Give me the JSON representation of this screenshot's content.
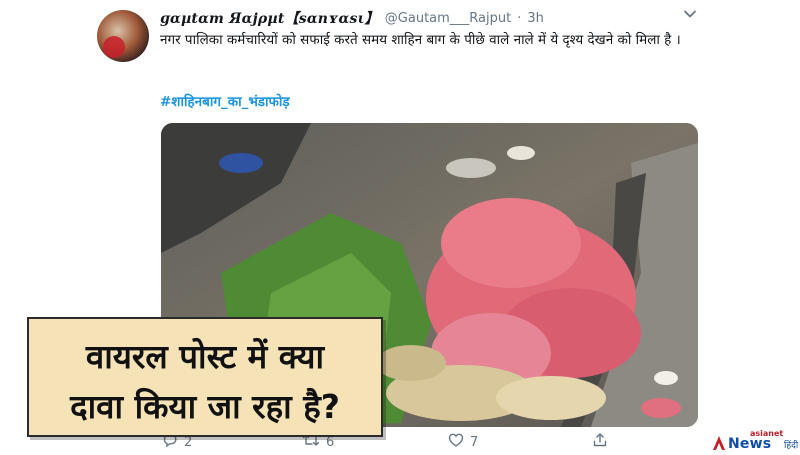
{
  "tweet": {
    "display_name": "ɡɑµtɑm Яɑjρµt【sɑnʏɑsι】",
    "handle": "@Gautam___Rajput",
    "separator": "·",
    "time": "3h",
    "text": "नगर पालिका कर्मचारियों को सफाई करते समय शाहिन बाग के पीछे वाले नाले में ये दृश्य देखने को मिला है ।",
    "hashtag": "#शाहिनबाग_का_भंडाफोड़",
    "icons": {
      "menu": "chevron-down-icon",
      "reply": "reply-icon",
      "retweet": "retweet-icon",
      "like": "heart-icon",
      "share": "share-icon"
    },
    "actions": {
      "replies": "2",
      "retweets": "6",
      "likes": "7"
    }
  },
  "overlay": {
    "line1": "वायरल पोस्ट में क्या",
    "line2": "दावा किया जा रहा है?"
  },
  "logo": {
    "top": "asianet",
    "news": "News",
    "hindi": "हिंदी",
    "accent": "#c0202a",
    "brand": "#0f4da8"
  },
  "colors": {
    "link": "#1b95e0",
    "muted": "#657786",
    "overlay_bg": "#f6e2b7"
  }
}
